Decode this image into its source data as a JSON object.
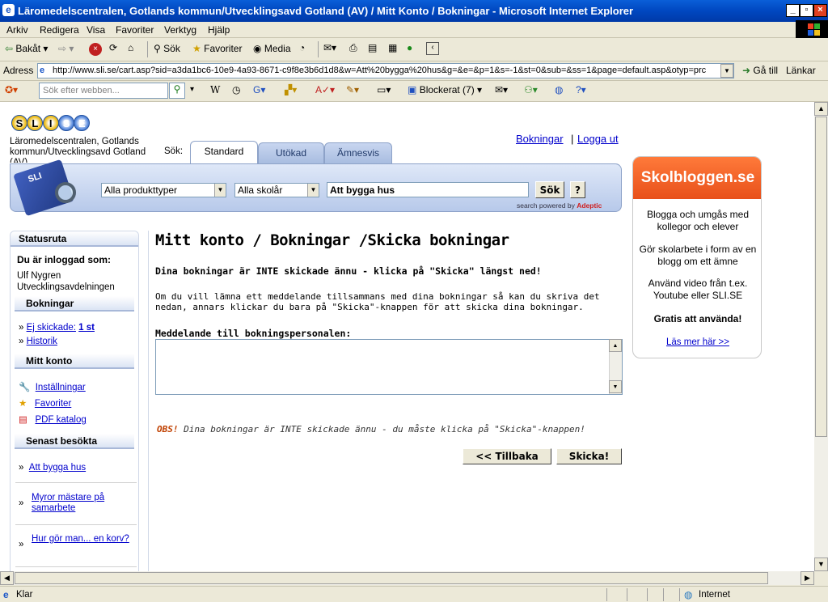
{
  "window": {
    "title": "Läromedelscentralen, Gotlands kommun/Utvecklingsavd Gotland (AV) / Mitt Konto / Bokningar - Microsoft Internet Explorer"
  },
  "menu": [
    "Arkiv",
    "Redigera",
    "Visa",
    "Favoriter",
    "Verktyg",
    "Hjälp"
  ],
  "toolbar": {
    "back": "Bakåt",
    "search": "Sök",
    "favorites": "Favoriter",
    "media": "Media"
  },
  "address": {
    "label": "Adress",
    "url": "http://www.sli.se/cart.asp?sid=a3da1bc6-10e9-4a93-8671-c9f8e3b6d1d8&w=Att%20bygga%20hus&g=&e=&p=1&s=-1&st=0&sub=&ss=1&page=default.asp&otyp=prc",
    "go": "Gå till",
    "links": "Länkar"
  },
  "ytoolbar": {
    "search_placeholder": "Sök efter webben...",
    "blocked": "Blockerat (7)"
  },
  "site": {
    "logo_letters": [
      "S",
      "L",
      "I",
      "S",
      "E"
    ],
    "org": "Läromedelscentralen, Gotlands kommun/Utvecklingsavd Gotland (AV)",
    "sok_label": "Sök:",
    "top_links": {
      "bookings": "Bokningar",
      "sep": "|",
      "logout": "Logga ut"
    },
    "tabs": [
      "Standard",
      "Utökad",
      "Ämnesvis"
    ],
    "search": {
      "product_type": "Alla produkttyper",
      "school": "Alla skolår",
      "query": "Att bygga hus",
      "button": "Sök",
      "help": "?",
      "powered": "search powered by ",
      "powered_brand": "Adeptic"
    }
  },
  "sidebar": {
    "status_title": "Statusruta",
    "logged_in_label": "Du är inloggad som:",
    "user": "Ulf Nygren Utvecklingsavdelningen",
    "bookings_title": "Bokningar",
    "not_sent": "Ej skickade:",
    "not_sent_count": "1 st",
    "history": "Historik",
    "account_title": "Mitt konto",
    "settings": "Inställningar",
    "favorites": "Favoriter",
    "pdf": "PDF katalog",
    "recent_title": "Senast besökta",
    "recent": [
      "Att bygga hus",
      "Myror mästare på samarbete",
      "Hur gör man... en korv?"
    ]
  },
  "main": {
    "title": "Mitt konto / Bokningar /Skicka bokningar",
    "warning": "Dina bokningar är INTE skickade ännu - klicka på \"Skicka\" längst ned!",
    "info": "Om du vill lämna ett meddelande tillsammans med dina bokningar så kan du skriva det nedan, annars klickar du bara på \"Skicka\"-knappen för att skicka dina bokningar.",
    "message_label": "Meddelande till bokningspersonalen:",
    "message_value": "",
    "obs_label": "OBS!",
    "obs_text": " Dina bokningar är INTE skickade ännu - du måste klicka på \"Skicka\"-knappen!",
    "back_button": "<< Tillbaka",
    "send_button": "Skicka!"
  },
  "ad": {
    "headline": "Skolbloggen.se",
    "p1": "Blogga och umgås med kollegor och elever",
    "p2": "Gör skolarbete i form av en blogg om ett ämne",
    "p3": "Använd video från t.ex. Youtube eller SLI.SE",
    "p4": "Gratis att använda!",
    "link": "Läs mer här >>"
  },
  "statusbar": {
    "text": "Klar",
    "zone": "Internet"
  }
}
